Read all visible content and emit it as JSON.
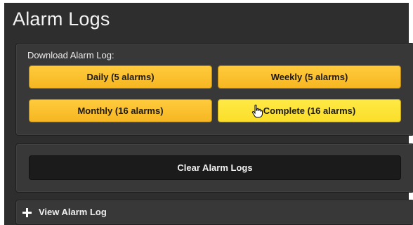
{
  "page": {
    "title": "Alarm Logs"
  },
  "download": {
    "label": "Download Alarm Log:",
    "buttons": [
      {
        "label": "Daily (5 alarms)"
      },
      {
        "label": "Weekly (5 alarms)"
      },
      {
        "label": "Monthly (16 alarms)"
      },
      {
        "label": "Complete (16 alarms)"
      }
    ]
  },
  "clear": {
    "label": "Clear Alarm Logs"
  },
  "view_log": {
    "label": "View Alarm Log"
  },
  "icons": {
    "expand": "plus-icon",
    "cursor": "hand-pointer-icon"
  },
  "colors": {
    "panel_bg": "#2e2e2e",
    "button_yellow": "#f8b928",
    "button_hover_yellow": "#fade2a",
    "clear_button_bg": "#1b1b1b",
    "text_light": "#f0f0f0"
  }
}
